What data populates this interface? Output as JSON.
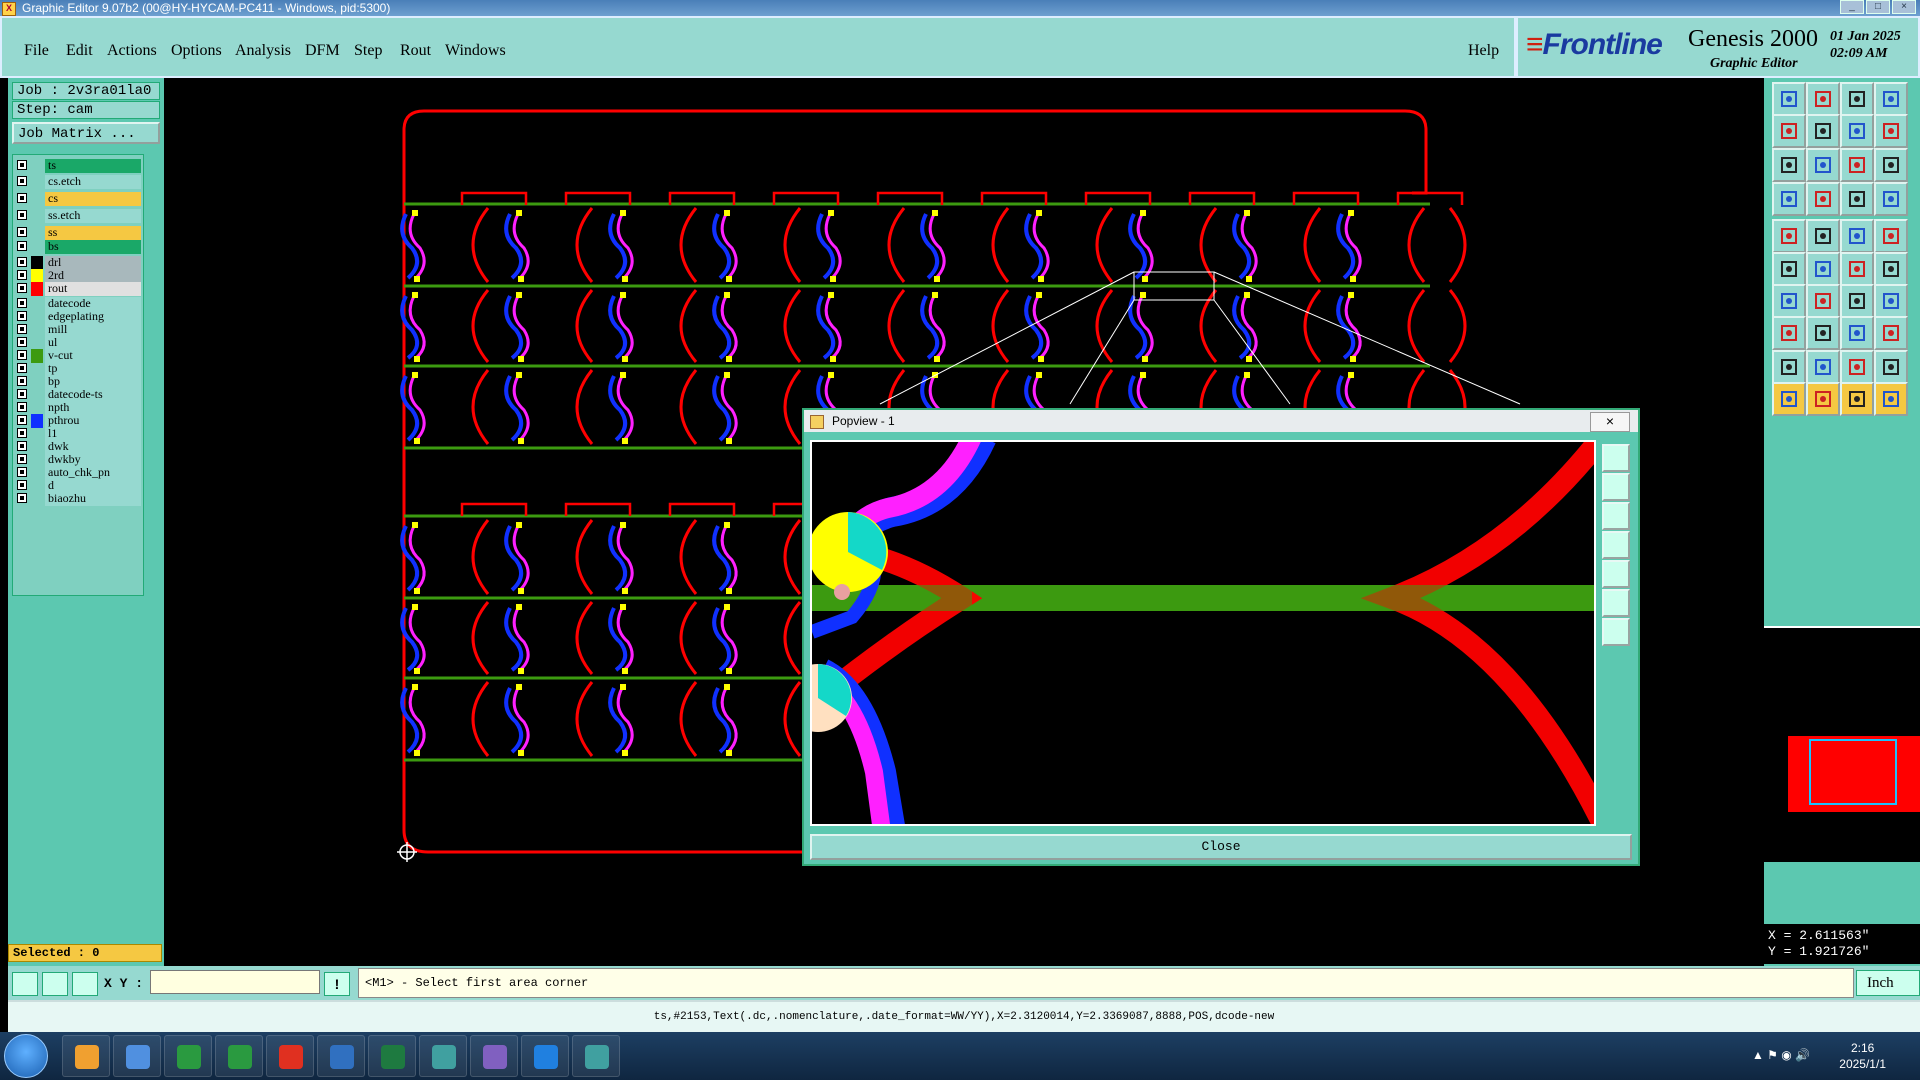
{
  "window": {
    "title": "Graphic Editor 9.07b2 (00@HY-HYCAM-PC411 - Windows, pid:5300)",
    "controls": [
      "_",
      "□",
      "×"
    ]
  },
  "menu": [
    "File",
    "Edit",
    "Actions",
    "Options",
    "Analysis",
    "DFM",
    "Step",
    "Rout",
    "Windows"
  ],
  "help": "Help",
  "brand": {
    "logo": "Frontline",
    "product": "Genesis 2000",
    "subtitle": "Graphic Editor",
    "date": "01 Jan 2025",
    "time": "02:09 AM"
  },
  "job": "Job : 2v3ra01la0",
  "step": "Step: cam",
  "job_matrix": "Job Matrix ...",
  "layers": [
    {
      "name": "ts",
      "color": "#1aa868"
    },
    {
      "name": "cs.etch",
      "color": "#96d9d0"
    },
    {
      "name": "cs",
      "color": "#f5c842"
    },
    {
      "name": "ss.etch",
      "color": "#96d9d0"
    },
    {
      "name": "ss",
      "color": "#f5c842"
    },
    {
      "name": "bs",
      "color": "#1aa868"
    },
    {
      "name": "drl",
      "color": "#a8b8bc",
      "swatch": "#000000"
    },
    {
      "name": "2rd",
      "color": "#a8b8bc",
      "swatch": "#ffff00"
    },
    {
      "name": "rout",
      "color": "#e0e0e0",
      "swatch": "#ff0000"
    },
    {
      "name": "datecode",
      "color": "#96d9d0"
    },
    {
      "name": "edgeplating",
      "color": "#96d9d0"
    },
    {
      "name": "mill",
      "color": "#96d9d0"
    },
    {
      "name": "ul",
      "color": "#96d9d0"
    },
    {
      "name": "v-cut",
      "color": "#96d9d0",
      "swatch": "#3c9a10"
    },
    {
      "name": "tp",
      "color": "#96d9d0"
    },
    {
      "name": "bp",
      "color": "#96d9d0"
    },
    {
      "name": "datecode-ts",
      "color": "#96d9d0"
    },
    {
      "name": "npth",
      "color": "#96d9d0"
    },
    {
      "name": "pthrou",
      "color": "#96d9d0",
      "swatch": "#1030ff"
    },
    {
      "name": "l1",
      "color": "#96d9d0"
    },
    {
      "name": "dwk",
      "color": "#96d9d0"
    },
    {
      "name": "dwkby",
      "color": "#96d9d0"
    },
    {
      "name": "auto_chk_pn",
      "color": "#96d9d0"
    },
    {
      "name": "d",
      "color": "#96d9d0"
    },
    {
      "name": "biaozhu",
      "color": "#96d9d0"
    }
  ],
  "selected": "Selected : 0",
  "xy_label": "X Y :",
  "xy_value": "",
  "prompt": "<M1> - Select first area corner",
  "units": "Inch",
  "status": "ts,#2153,Text(.dc,.nomenclature,.date_format=WW/YY),X=2.3120014,Y=2.3369087,8888,POS,dcode-new",
  "coords": {
    "x": "X = 2.611563\"",
    "y": "Y = 1.921726\""
  },
  "popview": {
    "title": "Popview - 1",
    "close_x": "×",
    "close": "Close"
  },
  "taskbar": {
    "time": "2:16",
    "date": "2025/1/1"
  },
  "colors": {
    "panel": "#96d9d0",
    "panel_dark": "#5cc8b0",
    "rout": "#ff0000",
    "vcut": "#3c9a10",
    "pthrou": "#1030ff",
    "drill": "#ffff00",
    "magenta": "#ff20ff"
  }
}
